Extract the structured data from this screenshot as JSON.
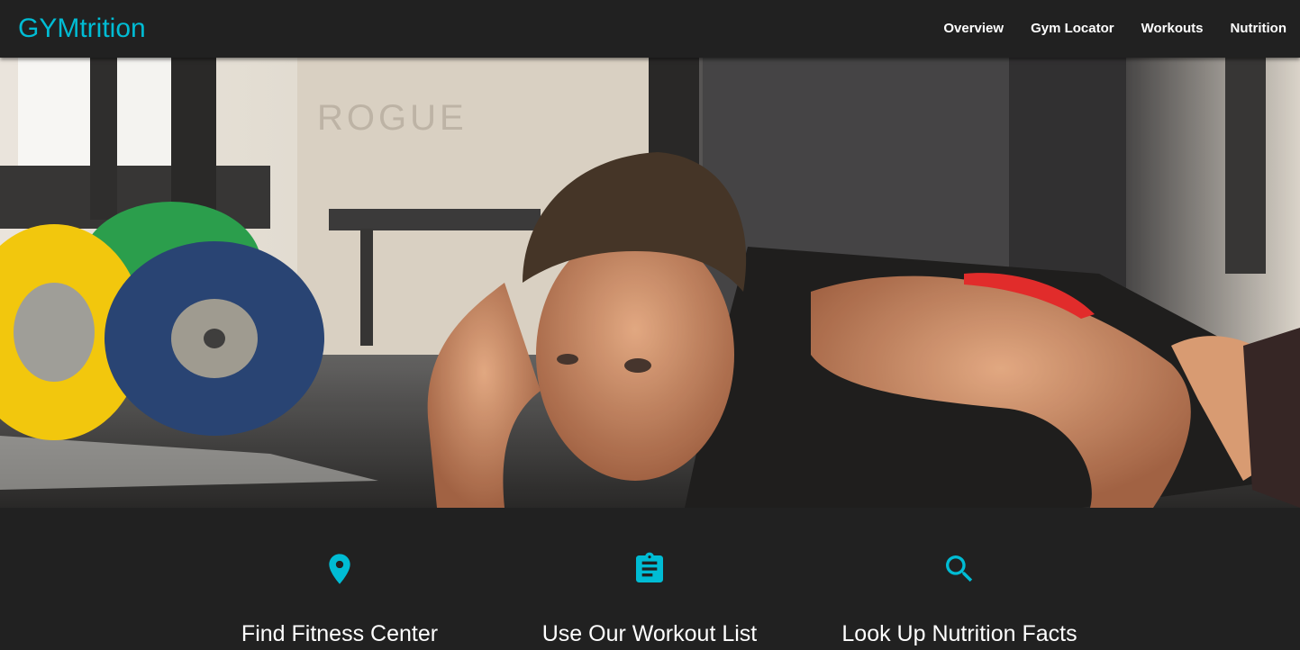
{
  "brand": {
    "name": "GYMtrition"
  },
  "colors": {
    "accent": "#00bcd4",
    "background": "#212121",
    "text": "#ffffff"
  },
  "nav": {
    "items": [
      {
        "label": "Overview"
      },
      {
        "label": "Gym Locator"
      },
      {
        "label": "Workouts"
      },
      {
        "label": "Nutrition"
      }
    ]
  },
  "features": [
    {
      "icon": "location-pin-icon",
      "title": "Find Fitness Center"
    },
    {
      "icon": "clipboard-list-icon",
      "title": "Use Our Workout List"
    },
    {
      "icon": "search-icon",
      "title": "Look Up Nutrition Facts"
    }
  ]
}
